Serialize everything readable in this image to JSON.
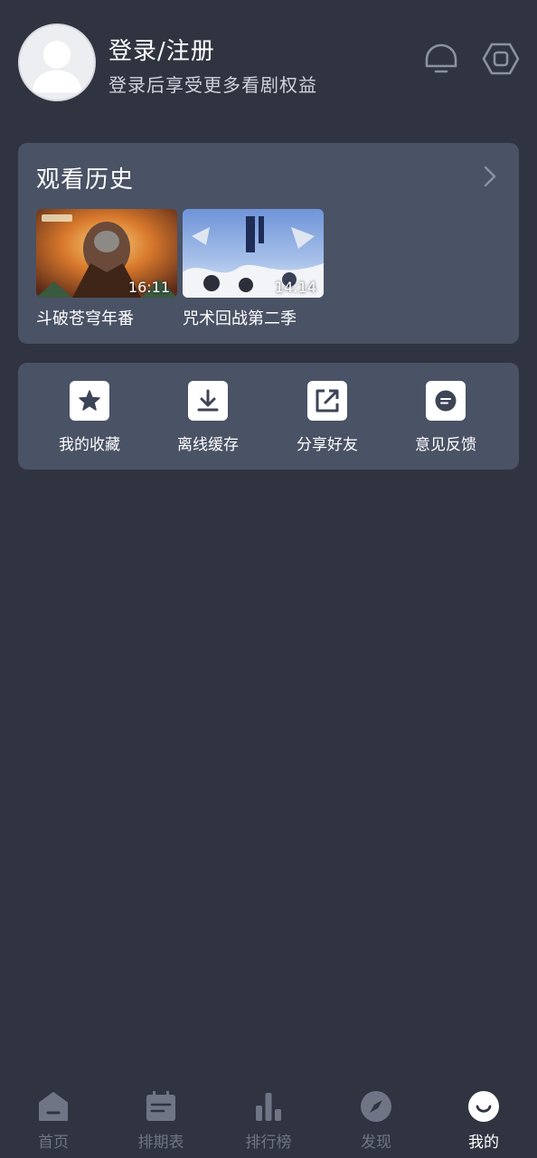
{
  "header": {
    "title": "登录/注册",
    "subtitle": "登录后享受更多看剧权益",
    "icons": [
      "avatar-placeholder",
      "bell-icon",
      "settings-icon"
    ]
  },
  "history": {
    "title": "观看历史",
    "items": [
      {
        "label": "斗破苍穹年番",
        "time": "16:11"
      },
      {
        "label": "咒术回战第二季",
        "time": "14:14"
      }
    ]
  },
  "actions": [
    {
      "label": "我的收藏",
      "icon": "star-icon"
    },
    {
      "label": "离线缓存",
      "icon": "download-icon"
    },
    {
      "label": "分享好友",
      "icon": "share-icon"
    },
    {
      "label": "意见反馈",
      "icon": "feedback-icon"
    }
  ],
  "nav": [
    {
      "label": "首页",
      "icon": "home-icon",
      "active": false
    },
    {
      "label": "排期表",
      "icon": "calendar-icon",
      "active": false
    },
    {
      "label": "排行榜",
      "icon": "bar-chart-icon",
      "active": false
    },
    {
      "label": "发现",
      "icon": "compass-icon",
      "active": false
    },
    {
      "label": "我的",
      "icon": "profile-icon",
      "active": true
    }
  ],
  "colors": {
    "background": "#2f3440",
    "card": "#4a5265",
    "nav_inactive": "#6f7585",
    "nav_active": "#ffffff"
  }
}
